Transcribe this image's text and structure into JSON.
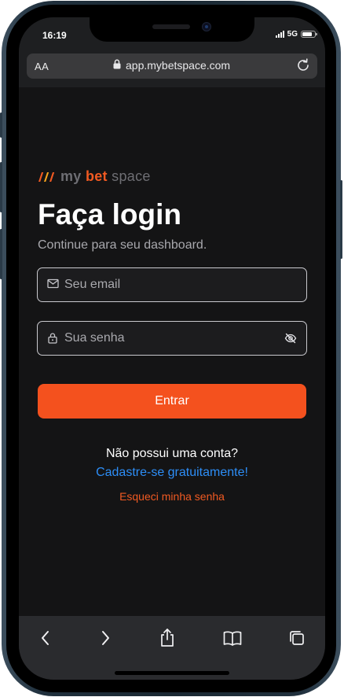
{
  "status": {
    "time": "16:19",
    "network": "5G",
    "battery_level": 0.8
  },
  "browser": {
    "text_size_label": "AA",
    "url": "app.mybetspace.com"
  },
  "logo": {
    "part1": "my",
    "part2": "bet",
    "part3": "space"
  },
  "login": {
    "title": "Faça login",
    "subtitle": "Continue para seu dashboard.",
    "email_placeholder": "Seu email",
    "password_placeholder": "Sua senha",
    "submit_label": "Entrar",
    "no_account_text": "Não possui uma conta?",
    "signup_link": "Cadastre-se gratuitamente!",
    "forgot_link": "Esqueci minha senha"
  },
  "colors": {
    "accent": "#f4511e",
    "link": "#2d8ef7",
    "background": "#141415"
  },
  "icons": {
    "email": "mail-icon",
    "password": "lock-icon",
    "visibility": "eye-off-icon",
    "toolbar": [
      "back-icon",
      "forward-icon",
      "share-icon",
      "bookmarks-icon",
      "tabs-icon"
    ]
  }
}
